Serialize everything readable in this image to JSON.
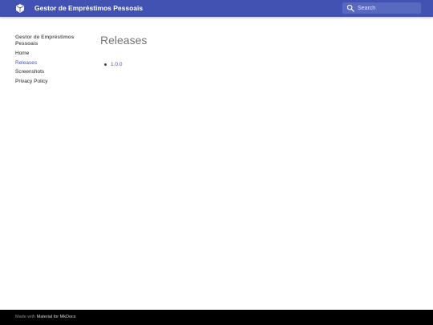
{
  "header": {
    "site_title": "Gestor de Empréstimos Pessoais",
    "logo_icon": "book-icon",
    "brand_color": "#4152b3"
  },
  "search": {
    "placeholder": "Search",
    "icon": "search-icon"
  },
  "sidebar": {
    "title": "Gestor de Empréstimos Pessoais",
    "items": [
      {
        "label": "Home",
        "active": false
      },
      {
        "label": "Releases",
        "active": true
      },
      {
        "label": "Screenshots",
        "active": false
      },
      {
        "label": "Privacy Policy",
        "active": false
      }
    ]
  },
  "main": {
    "title": "Releases",
    "releases": [
      "1.0.0"
    ]
  },
  "footer": {
    "made_with": "Made with",
    "link_text": "Material for MkDocs"
  }
}
